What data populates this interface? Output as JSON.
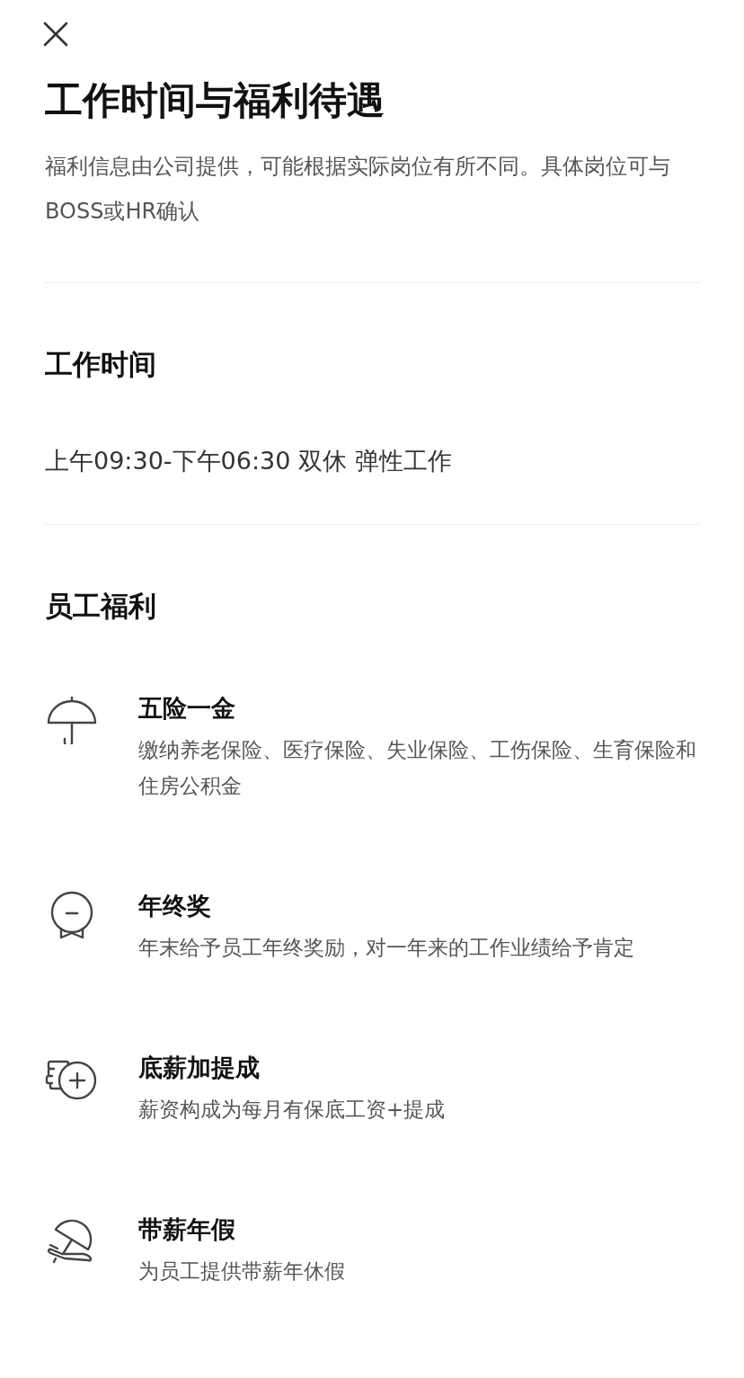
{
  "title": "工作时间与福利待遇",
  "subtitle": "福利信息由公司提供，可能根据实际岗位有所不同。具体岗位可与BOSS或HR确认",
  "work_time": {
    "heading": "工作时间",
    "text": "上午09:30-下午06:30 双休 弹性工作"
  },
  "benefits": {
    "heading": "员工福利",
    "items": [
      {
        "title": "五险一金",
        "description": "缴纳养老保险、医疗保险、失业保险、工伤保险、生育保险和住房公积金"
      },
      {
        "title": "年终奖",
        "description": "年末给予员工年终奖励，对一年来的工作业绩给予肯定"
      },
      {
        "title": "底薪加提成",
        "description": "薪资构成为每月有保底工资+提成"
      },
      {
        "title": "带薪年假",
        "description": "为员工提供带薪年休假"
      }
    ]
  }
}
